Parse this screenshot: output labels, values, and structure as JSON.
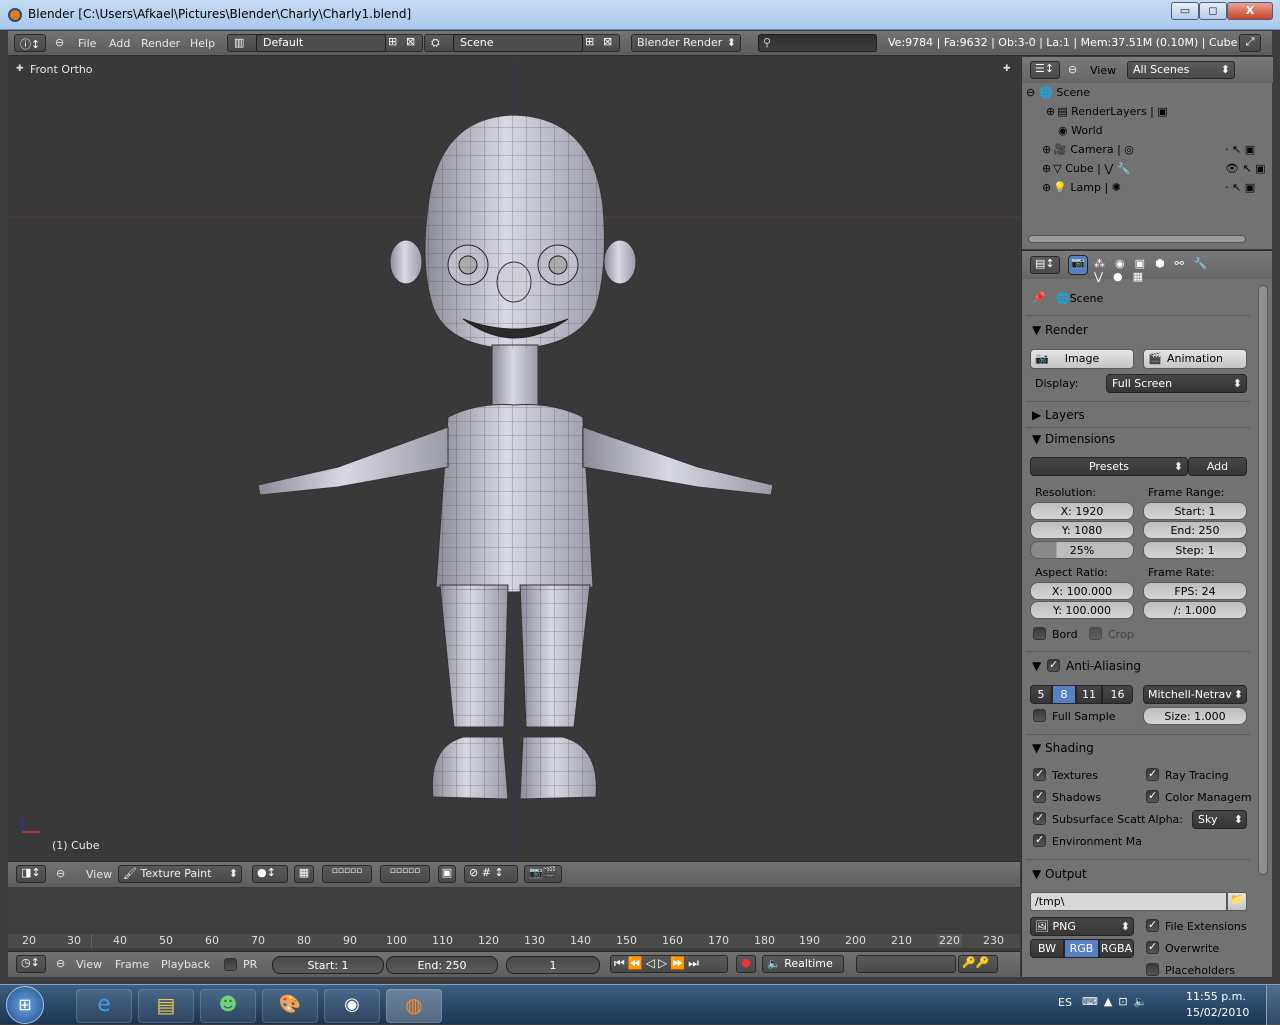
{
  "window": {
    "title": "Blender [C:\\Users\\Afkael\\Pictures\\Blender\\Charly\\Charly1.blend]",
    "min": "▭",
    "max": "◻",
    "close": "X"
  },
  "info": {
    "menus": [
      "File",
      "Add",
      "Render",
      "Help"
    ],
    "screen": "Default",
    "scene": "Scene",
    "engine": "Blender Render",
    "stats": "Ve:9784 | Fa:9632 | Ob:3-0 | La:1 | Mem:37.51M (0.10M) | Cube"
  },
  "viewport": {
    "label": "Front Ortho",
    "object": "(1) Cube"
  },
  "view3d_header": {
    "view": "View",
    "mode": "Texture Paint"
  },
  "timeline": {
    "ruler": [
      "20",
      "30",
      "40",
      "50",
      "60",
      "70",
      "80",
      "90",
      "100",
      "110",
      "120",
      "130",
      "140",
      "150",
      "160",
      "170",
      "180",
      "190",
      "200",
      "210",
      "220",
      "230"
    ],
    "view": "View",
    "frame": "Frame",
    "playback": "Playback",
    "pr": "PR",
    "start": "Start: 1",
    "end": "End: 250",
    "current": "1",
    "sync": "Realtime"
  },
  "outliner": {
    "view": "View",
    "display": "All Scenes",
    "items": [
      "Scene",
      "RenderLayers",
      "World",
      "Camera",
      "Cube",
      "Lamp"
    ]
  },
  "properties": {
    "context": "Scene",
    "render": {
      "title": "Render",
      "image": "Image",
      "animation": "Animation",
      "display_label": "Display:",
      "display": "Full Screen"
    },
    "layers": "Layers",
    "dimensions": {
      "title": "Dimensions",
      "presets": "Presets",
      "add": "Add",
      "res_label": "Resolution:",
      "res_x": "X: 1920",
      "res_y": "Y: 1080",
      "res_pct": "25%",
      "fr_label": "Frame Range:",
      "start": "Start: 1",
      "end": "End: 250",
      "step": "Step: 1",
      "aspect_label": "Aspect Ratio:",
      "ax": "X: 100.000",
      "ay": "Y: 100.000",
      "rate_label": "Frame Rate:",
      "fps": "FPS: 24",
      "base": "/: 1.000",
      "bord": "Bord",
      "crop": "Crop"
    },
    "aa": {
      "title": "Anti-Aliasing",
      "s5": "5",
      "s8": "8",
      "s11": "11",
      "s16": "16",
      "filter": "Mitchell-Netrav",
      "full": "Full Sample",
      "size": "Size: 1.000"
    },
    "shading": {
      "title": "Shading",
      "textures": "Textures",
      "raytracing": "Ray Tracing",
      "shadows": "Shadows",
      "color": "Color Managem",
      "sss": "Subsurface Scatt",
      "alpha_label": "Alpha:",
      "alpha": "Sky",
      "env": "Environment Ma"
    },
    "output": {
      "title": "Output",
      "path": "/tmp\\",
      "format": "PNG",
      "bw": "BW",
      "rgb": "RGB",
      "rgba": "RGBA",
      "ext": "File Extensions",
      "overwrite": "Overwrite",
      "placeholders": "Placeholders"
    }
  },
  "taskbar": {
    "lang": "ES",
    "time": "11:55 p.m.",
    "date": "15/02/2010"
  }
}
